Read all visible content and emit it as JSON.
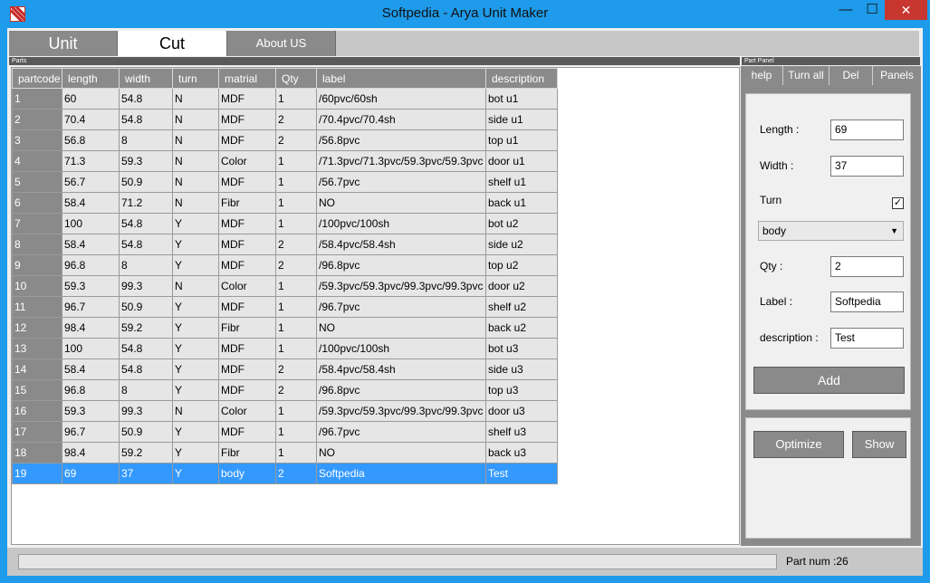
{
  "window": {
    "title": "Softpedia - Arya Unit Maker",
    "minimize": "—",
    "maximize": "☐",
    "close": "✕"
  },
  "tabs": {
    "unit": "Unit",
    "cut": "Cut",
    "about": "About US"
  },
  "strips": {
    "parts": "Parts",
    "panel": "Part Panel"
  },
  "grid": {
    "columns": [
      "partcode",
      "length",
      "width",
      "turn",
      "matrial",
      "Qty",
      "label",
      "description"
    ],
    "rows": [
      [
        "1",
        "60",
        "54.8",
        "N",
        "MDF",
        "1",
        "/60pvc/60sh",
        "bot u1"
      ],
      [
        "2",
        "70.4",
        "54.8",
        "N",
        "MDF",
        "2",
        "/70.4pvc/70.4sh",
        "side u1"
      ],
      [
        "3",
        "56.8",
        "8",
        "N",
        "MDF",
        "2",
        "/56.8pvc",
        "top u1"
      ],
      [
        "4",
        "71.3",
        "59.3",
        "N",
        "Color",
        "1",
        "/71.3pvc/71.3pvc/59.3pvc/59.3pvc",
        "door u1"
      ],
      [
        "5",
        "56.7",
        "50.9",
        "N",
        "MDF",
        "1",
        "/56.7pvc",
        "shelf u1"
      ],
      [
        "6",
        "58.4",
        "71.2",
        "N",
        "Fibr",
        "1",
        "NO",
        "back u1"
      ],
      [
        "7",
        "100",
        "54.8",
        "Y",
        "MDF",
        "1",
        "/100pvc/100sh",
        "bot u2"
      ],
      [
        "8",
        "58.4",
        "54.8",
        "Y",
        "MDF",
        "2",
        "/58.4pvc/58.4sh",
        "side u2"
      ],
      [
        "9",
        "96.8",
        "8",
        "Y",
        "MDF",
        "2",
        "/96.8pvc",
        "top u2"
      ],
      [
        "10",
        "59.3",
        "99.3",
        "N",
        "Color",
        "1",
        "/59.3pvc/59.3pvc/99.3pvc/99.3pvc",
        "door u2"
      ],
      [
        "11",
        "96.7",
        "50.9",
        "Y",
        "MDF",
        "1",
        "/96.7pvc",
        "shelf u2"
      ],
      [
        "12",
        "98.4",
        "59.2",
        "Y",
        "Fibr",
        "1",
        "NO",
        "back u2"
      ],
      [
        "13",
        "100",
        "54.8",
        "Y",
        "MDF",
        "1",
        "/100pvc/100sh",
        "bot u3"
      ],
      [
        "14",
        "58.4",
        "54.8",
        "Y",
        "MDF",
        "2",
        "/58.4pvc/58.4sh",
        "side u3"
      ],
      [
        "15",
        "96.8",
        "8",
        "Y",
        "MDF",
        "2",
        "/96.8pvc",
        "top u3"
      ],
      [
        "16",
        "59.3",
        "99.3",
        "N",
        "Color",
        "1",
        "/59.3pvc/59.3pvc/99.3pvc/99.3pvc",
        "door u3"
      ],
      [
        "17",
        "96.7",
        "50.9",
        "Y",
        "MDF",
        "1",
        "/96.7pvc",
        "shelf u3"
      ],
      [
        "18",
        "98.4",
        "59.2",
        "Y",
        "Fibr",
        "1",
        "NO",
        "back u3"
      ],
      [
        "19",
        "69",
        "37",
        "Y",
        "body",
        "2",
        "Softpedia",
        "Test"
      ]
    ],
    "selected_row": 19
  },
  "panel": {
    "tabs": {
      "help": "help",
      "turn_all": "Turn all",
      "del": "Del",
      "panels": "Panels"
    },
    "length_label": "Length :",
    "length_value": "69",
    "width_label": "Width :",
    "width_value": "37",
    "turn_label": "Turn",
    "turn_checked": "✓",
    "material_value": "body",
    "material_chevron": "▼",
    "qty_label": "Qty :",
    "qty_value": "2",
    "label_label": "Label :",
    "label_value": "Softpedia",
    "desc_label": "description :",
    "desc_value": "Test",
    "add_button": "Add",
    "optimize_button": "Optimize",
    "show_button": "Show"
  },
  "status": {
    "part_num": "Part num :26",
    "progress": 0
  }
}
